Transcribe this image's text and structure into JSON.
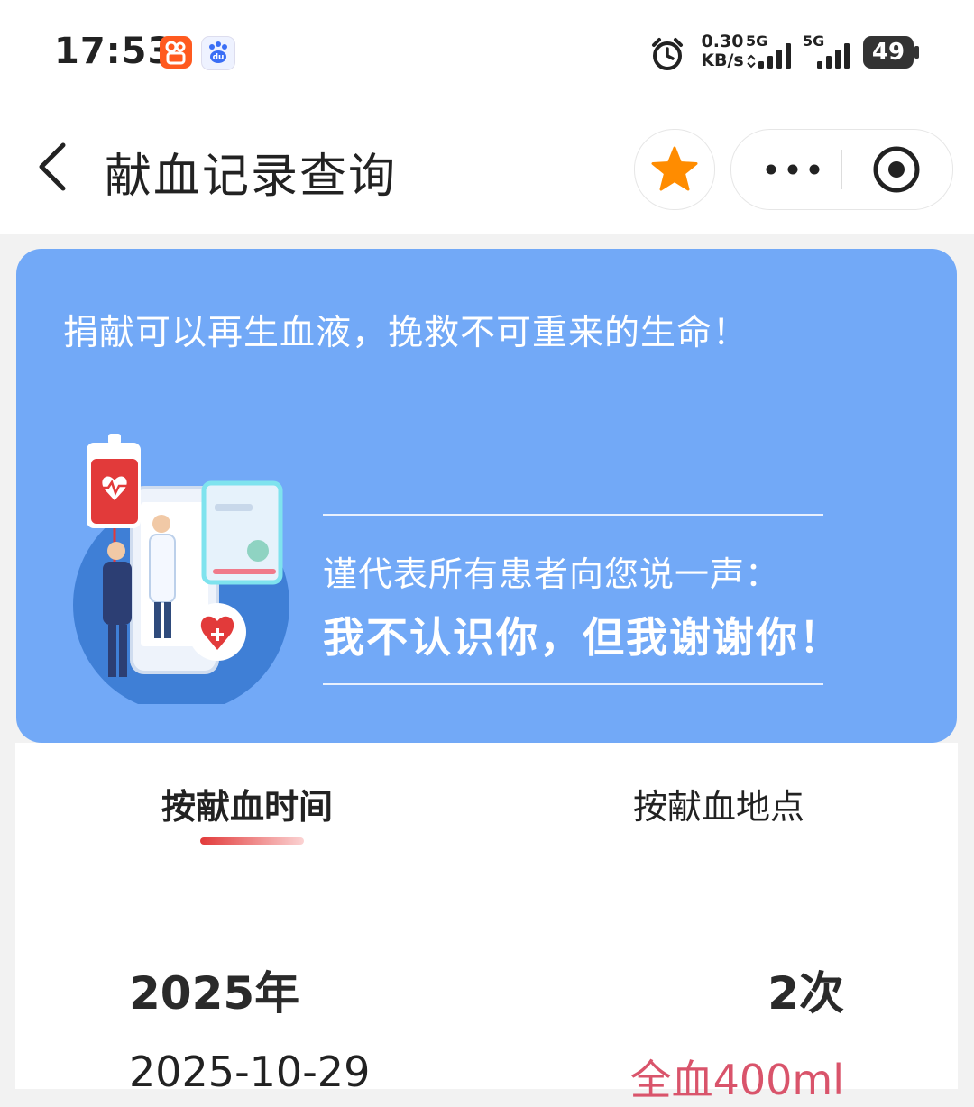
{
  "status_bar": {
    "time": "17:53",
    "net_speed_value": "0.30",
    "net_speed_unit": "KB/s",
    "sim1_label": "5G",
    "sim2_label": "5G",
    "battery": "49"
  },
  "nav": {
    "title": "献血记录查询",
    "back_icon": "chevron-left-icon",
    "favorite_icon": "star-icon",
    "more_icon": "more-dots-icon",
    "close_icon": "target-icon"
  },
  "banner": {
    "slogan": "捐献可以再生血液，挽救不可重来的生命！",
    "thanks_sub": "谨代表所有患者向您说一声：",
    "thanks_main": "我不认识你，但我谢谢你！"
  },
  "tabs": [
    {
      "label": "按献血时间",
      "active": true
    },
    {
      "label": "按献血地点",
      "active": false
    }
  ],
  "records": {
    "year_label": "2025年",
    "year_count": "2次",
    "items": [
      {
        "date": "2025-10-29",
        "type": "全血400ml"
      }
    ]
  },
  "colors": {
    "banner_bg": "#72a9f7",
    "accent_red": "#e23a3a",
    "favorite_star": "#ff8c00",
    "record_type": "#d9546b"
  }
}
